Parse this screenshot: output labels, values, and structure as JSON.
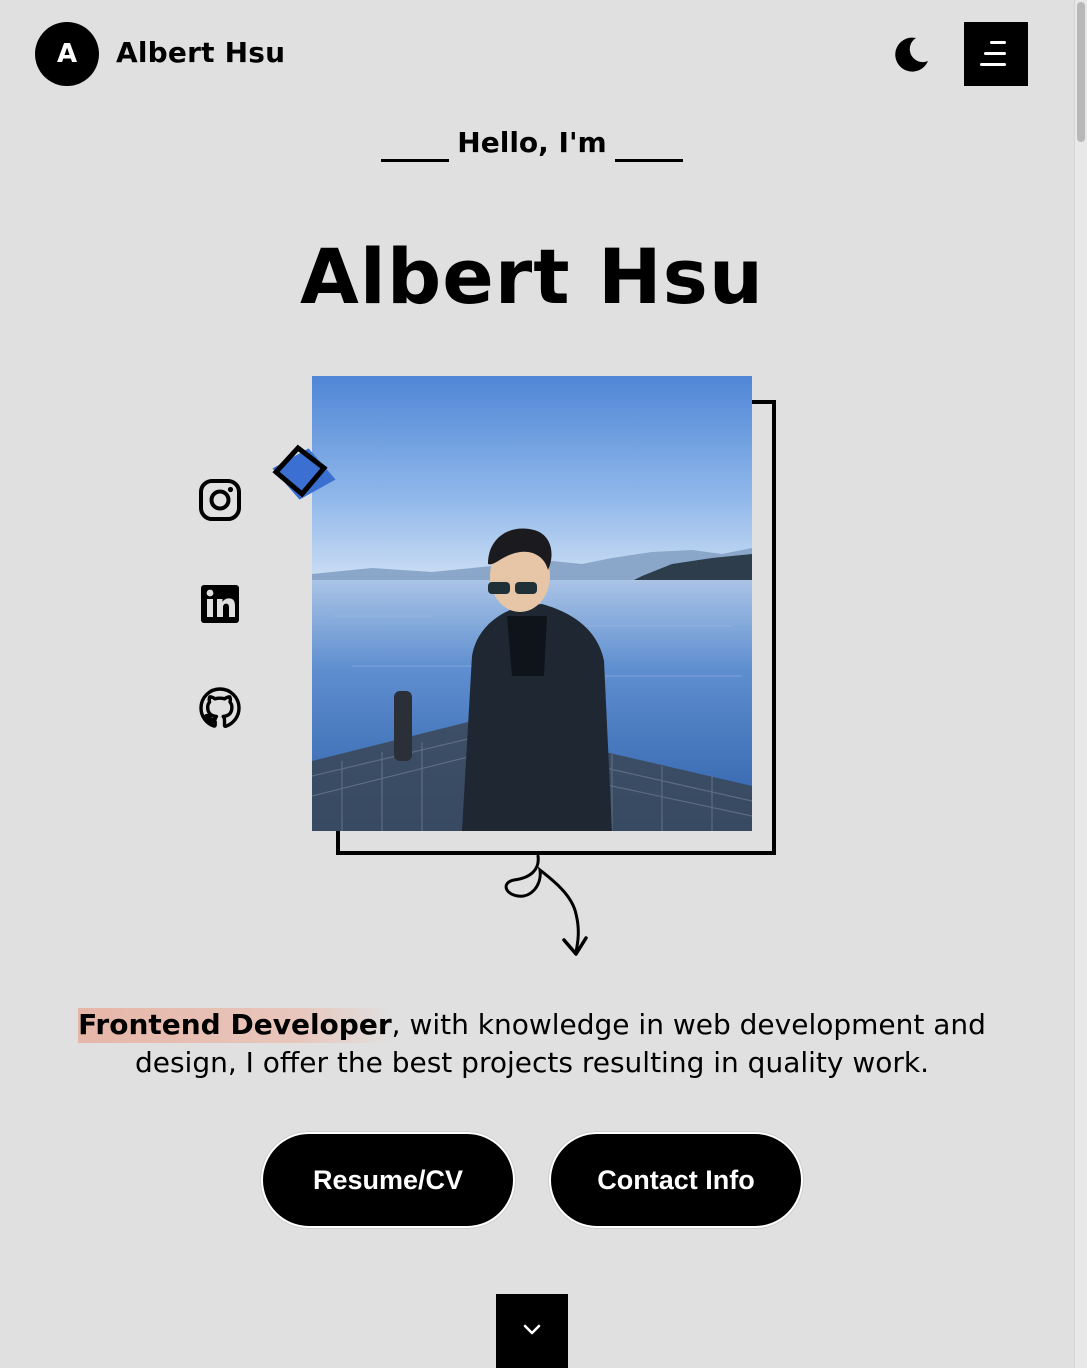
{
  "header": {
    "logo_letter": "A",
    "logo_name": "Albert Hsu",
    "theme_icon": "moon-icon",
    "menu_icon": "hamburger-menu-icon"
  },
  "hero": {
    "greeting": "Hello, I'm",
    "name": "Albert Hsu",
    "photo_alt": "Albert Hsu standing by a lake"
  },
  "social": [
    {
      "name": "instagram",
      "icon": "instagram-icon"
    },
    {
      "name": "linkedin",
      "icon": "linkedin-icon"
    },
    {
      "name": "github",
      "icon": "github-icon"
    }
  ],
  "tagline": {
    "highlight": "Frontend Developer",
    "rest": ", with knowledge in web development and design, I offer the best projects resulting in quality work."
  },
  "buttons": {
    "resume": "Resume/CV",
    "contact": "Contact Info"
  },
  "scroll_down_icon": "chevron-down-icon",
  "colors": {
    "background": "#e0e0e0",
    "primary": "#000000",
    "accent_blue": "#3b6fd1",
    "highlight": "#e6b6a8"
  }
}
